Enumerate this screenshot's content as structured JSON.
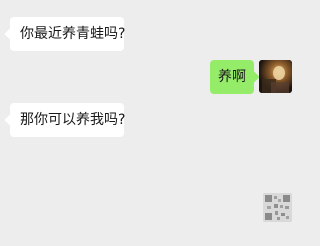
{
  "messages": [
    {
      "side": "left",
      "text": "你最近养青蛙吗?"
    },
    {
      "side": "right",
      "text": "养啊"
    },
    {
      "side": "left",
      "text": "那你可以养我吗?"
    }
  ],
  "colors": {
    "background": "#ededed",
    "incoming_bubble": "#ffffff",
    "outgoing_bubble": "#95ec69",
    "text": "#191919"
  },
  "icons": {
    "avatar": "user-avatar-photo",
    "corner_mark": "qr-code-icon"
  }
}
